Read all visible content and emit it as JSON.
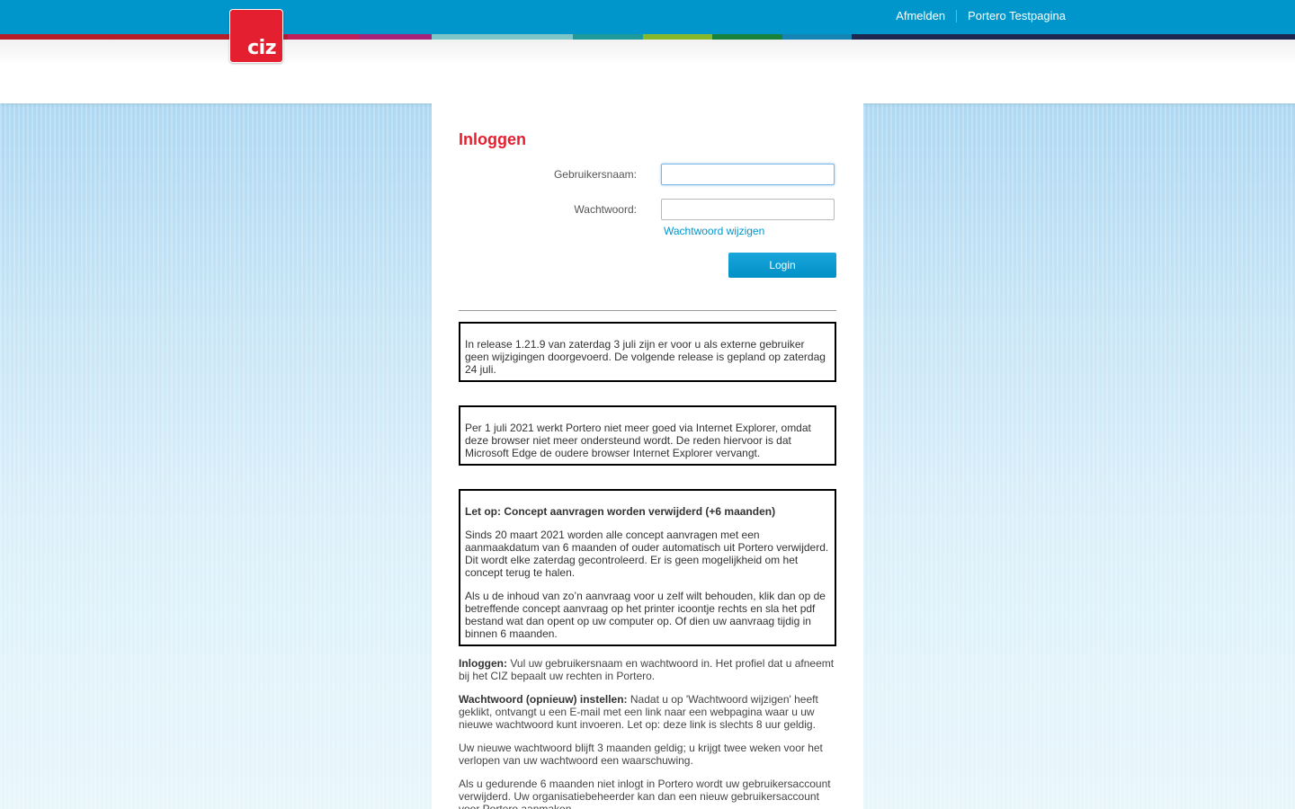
{
  "brand": {
    "logo_text": "ciz"
  },
  "colors": {
    "topbar": "#0096cc",
    "accent_red": "#e41f2f",
    "link": "#0096cc",
    "band": [
      "#b71c2b",
      "#b71c2b",
      "#c01f5c",
      "#a4247a",
      "#7fc6c9",
      "#1f9a9a",
      "#86b82a",
      "#18813a",
      "#1583b3",
      "#1d2750",
      "#1d2750"
    ]
  },
  "toplinks": {
    "logout": "Afmelden",
    "testpage": "Portero Testpagina"
  },
  "login": {
    "title": "Inloggen",
    "username_label": "Gebruikersnaam:",
    "username_value": "",
    "password_label": "Wachtwoord:",
    "password_value": "",
    "change_password_link": "Wachtwoord wijzigen",
    "login_button": "Login"
  },
  "notices": [
    {
      "text": "In release 1.21.9 van zaterdag 3 juli zijn er voor u als externe gebruiker geen wijzigingen doorgevoerd. De volgende release is gepland op zaterdag 24 juli."
    },
    {
      "text": "Per 1 juli 2021 werkt Portero niet meer goed via Internet Explorer, omdat deze browser niet meer ondersteund wordt. De reden hiervoor is dat Microsoft Edge de oudere browser Internet Explorer vervangt."
    },
    {
      "heading": "Let op: Concept aanvragen worden verwijderd (+6 maanden)",
      "p1": "Sinds 20 maart 2021 worden alle concept aanvragen met een aanmaakdatum van 6 maanden of ouder automatisch uit Portero verwijderd. Dit wordt elke zaterdag gecontroleerd. Er is geen mogelijkheid om het concept terug te halen.",
      "p2": "Als u de inhoud van zo’n aanvraag voor u zelf wilt behouden, klik dan op de betreffende concept aanvraag op het printer icoontje rechts en sla het pdf bestand wat dan opent op uw computer op. Of dien uw aanvraag tijdig in binnen 6 maanden."
    }
  ],
  "info": {
    "login_label": "Inloggen:",
    "login_text": "Vul uw gebruikersnaam en wachtwoord in. Het profiel dat u afneemt bij het CIZ bepaalt uw rechten in Portero.",
    "reset_label": "Wachtwoord (opnieuw) instellen:",
    "reset_text": "Nadat u op 'Wachtwoord wijzigen' heeft geklikt, ontvangt u een E-mail met een link naar een webpagina waar u uw nieuwe wachtwoord kunt invoeren. Let op: deze link is slechts 8 uur geldig.",
    "validity_text": "Uw nieuwe wachtwoord blijft 3 maanden geldig; u krijgt twee weken voor het verlopen van uw wachtwoord een waarschuwing.",
    "inactive_text": "Als u gedurende 6 maanden niet inlogt in Portero wordt uw gebruikersaccount verwijderd. Uw organisatiebeheerder kan dan een nieuw gebruikersaccount voor Portero aanmaken."
  }
}
